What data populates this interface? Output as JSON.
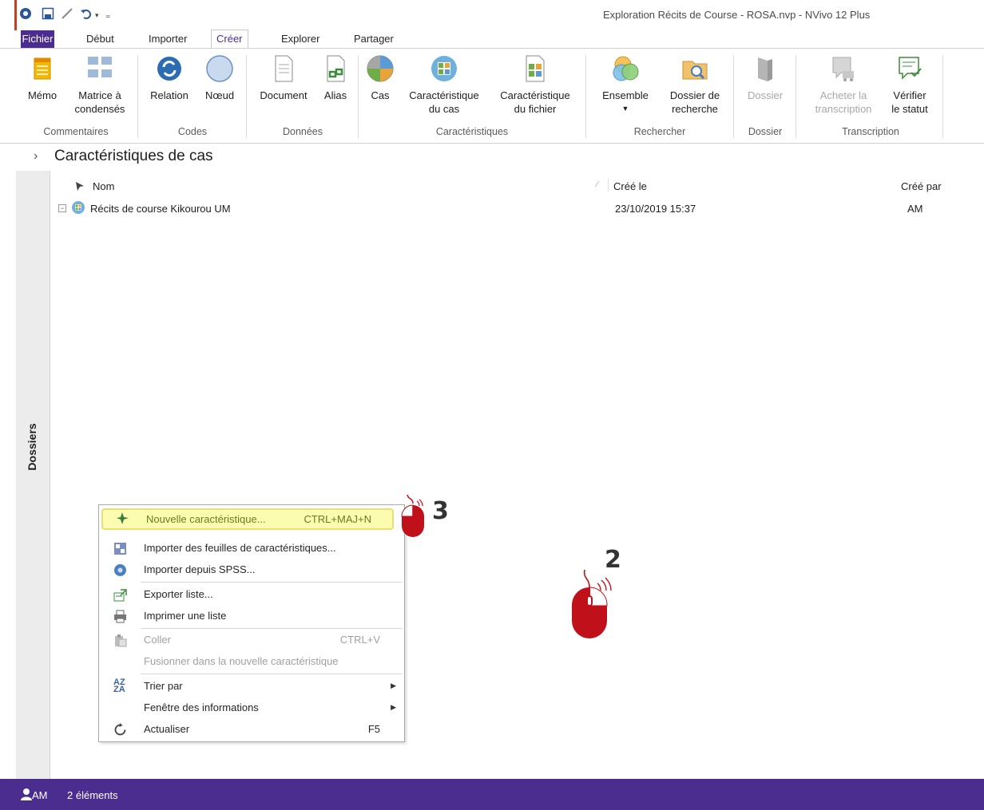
{
  "window": {
    "title": "Exploration Récits de Course - ROSA.nvp - NVivo 12 Plus"
  },
  "ribbon_tabs": [
    {
      "label": "Fichier"
    },
    {
      "label": "Début"
    },
    {
      "label": "Importer"
    },
    {
      "label": "Créer"
    },
    {
      "label": "Explorer"
    },
    {
      "label": "Partager"
    }
  ],
  "ribbon": {
    "buttons": {
      "memo": "Mémo",
      "matrix_l1": "Matrice à",
      "matrix_l2": "condensés",
      "relation": "Relation",
      "node": "Nœud",
      "document": "Document",
      "alias": "Alias",
      "case": "Cas",
      "case_class_l1": "Caractéristique",
      "case_class_l2": "du cas",
      "file_class_l1": "Caractéristique",
      "file_class_l2": "du fichier",
      "set": "Ensemble",
      "search_folder_l1": "Dossier de",
      "search_folder_l2": "recherche",
      "folder": "Dossier",
      "buy_trans_l1": "Acheter la",
      "buy_trans_l2": "transcription",
      "check_status_l1": "Vérifier",
      "check_status_l2": "le statut"
    },
    "groups": {
      "comments": "Commentaires",
      "codes": "Codes",
      "data": "Données",
      "classifications": "Caractéristiques",
      "search": "Rechercher",
      "folder": "Dossier",
      "transcription": "Transcription"
    }
  },
  "panel": {
    "title": "Caractéristiques de cas",
    "sidebar_label": "Dossiers",
    "columns": {
      "name": "Nom",
      "created_on": "Créé le",
      "created_by": "Créé par"
    },
    "rows": [
      {
        "name": "Récits de course Kikourou UM",
        "created_on": "23/10/2019 15:37",
        "created_by": "AM"
      }
    ]
  },
  "context_menu": {
    "items": [
      {
        "label": "Nouvelle caractéristique...",
        "shortcut": "CTRL+MAJ+N",
        "highlighted": true,
        "icon": "new-classification-icon"
      },
      {
        "label": "Importer des feuilles de caractéristiques...",
        "icon": "import-sheets-icon"
      },
      {
        "label": "Importer depuis SPSS...",
        "icon": "spss-icon"
      },
      {
        "label": "Exporter liste...",
        "icon": "export-icon"
      },
      {
        "label": "Imprimer une liste",
        "icon": "print-icon"
      },
      {
        "label": "Coller",
        "shortcut": "CTRL+V",
        "disabled": true,
        "icon": "paste-icon"
      },
      {
        "label": "Fusionner dans la nouvelle caractéristique",
        "disabled": true
      },
      {
        "label": "Trier par",
        "submenu": true,
        "icon": "sort-icon"
      },
      {
        "label": "Fenêtre des informations",
        "submenu": true
      },
      {
        "label": "Actualiser",
        "shortcut": "F5",
        "icon": "refresh-icon"
      }
    ]
  },
  "annotations": {
    "step_2": "2",
    "step_3": "3"
  },
  "status": {
    "user": "AM",
    "count": "2 éléments"
  },
  "colors": {
    "brand": "#4b2d8f",
    "mouse_red": "#c0101a",
    "highlight": "#fbfcb0"
  }
}
